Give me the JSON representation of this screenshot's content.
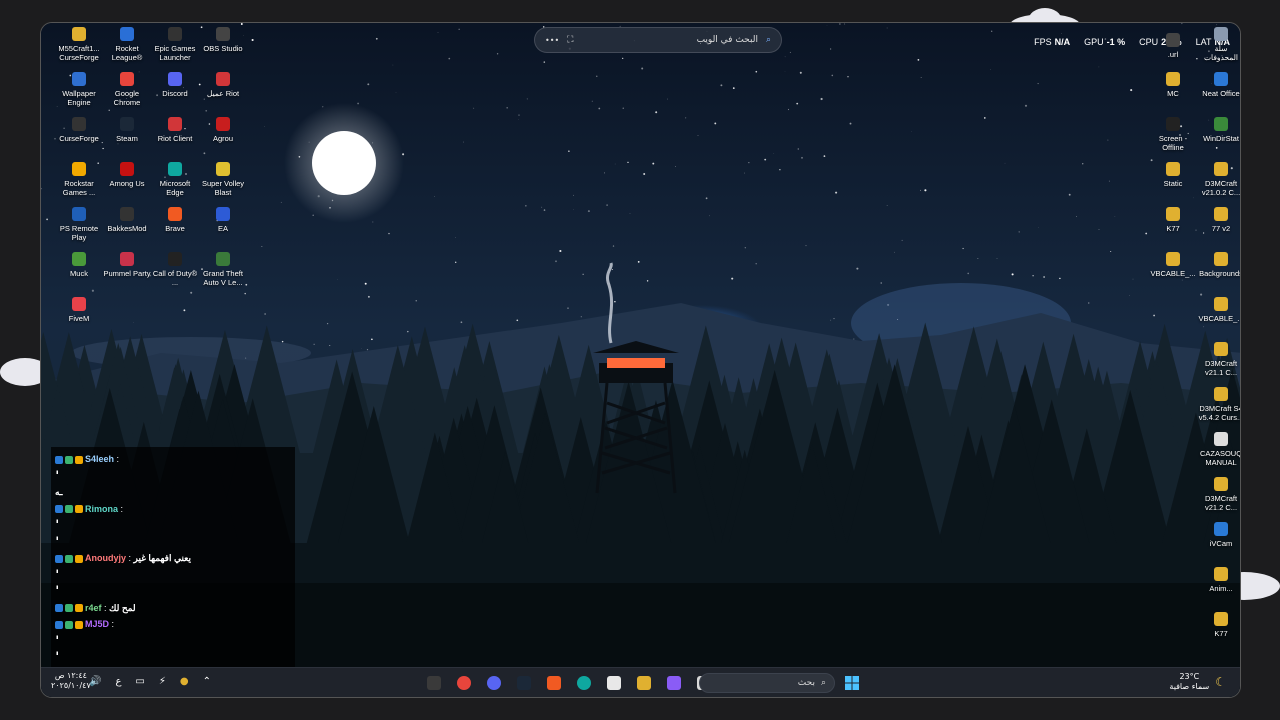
{
  "search_pill": {
    "placeholder": "البحث في الويب",
    "more": "•••"
  },
  "perf": [
    {
      "label": "LAT",
      "value": "N/A"
    },
    {
      "label": "CPU",
      "value": "23 %"
    },
    {
      "label": "GPU",
      "value": "-1 %"
    },
    {
      "label": "FPS",
      "value": "N/A"
    }
  ],
  "desktop_left": [
    {
      "label": "M55Craft1... CurseForge",
      "icon": "folder-icon",
      "color": "#e0b030"
    },
    {
      "label": "Rocket League®",
      "icon": "rocket-league-icon",
      "color": "#2a6fd6"
    },
    {
      "label": "Epic Games Launcher",
      "icon": "epic-icon",
      "color": "#333"
    },
    {
      "label": "OBS Studio",
      "icon": "obs-icon",
      "color": "#444"
    },
    {
      "label": "Wallpaper Engine",
      "icon": "wallpaper-engine-icon",
      "color": "#2f6fd0"
    },
    {
      "label": "Google Chrome",
      "icon": "chrome-icon",
      "color": "#e8453c"
    },
    {
      "label": "Discord",
      "icon": "discord-icon",
      "color": "#5865f2"
    },
    {
      "label": "عميل Riot",
      "icon": "riot-icon",
      "color": "#d13639"
    },
    {
      "label": "CurseForge",
      "icon": "curseforge-icon",
      "color": "#333"
    },
    {
      "label": "Steam",
      "icon": "steam-icon",
      "color": "#1b2838"
    },
    {
      "label": "Riot Client",
      "icon": "riot-client-icon",
      "color": "#d13639"
    },
    {
      "label": "Agrou",
      "icon": "agrou-icon",
      "color": "#c81e1e"
    },
    {
      "label": "Rockstar Games ...",
      "icon": "rockstar-icon",
      "color": "#f2a900"
    },
    {
      "label": "Among Us",
      "icon": "among-us-icon",
      "color": "#c51111"
    },
    {
      "label": "Microsoft Edge",
      "icon": "edge-icon",
      "color": "#0fa8a0"
    },
    {
      "label": "Super Volley Blast",
      "icon": "volley-icon",
      "color": "#e0c030"
    },
    {
      "label": "PS Remote Play",
      "icon": "ps-remote-icon",
      "color": "#1f5fb8"
    },
    {
      "label": "BakkesMod",
      "icon": "bakkesmod-icon",
      "color": "#333"
    },
    {
      "label": "Brave",
      "icon": "brave-icon",
      "color": "#f15a22"
    },
    {
      "label": "EA",
      "icon": "ea-icon",
      "color": "#2d5bd6"
    },
    {
      "label": "Muck",
      "icon": "muck-icon",
      "color": "#4a9a3a"
    },
    {
      "label": "Pummel Party",
      "icon": "pummel-party-icon",
      "color": "#c8324a"
    },
    {
      "label": "Call of Duty® ...",
      "icon": "cod-icon",
      "color": "#222"
    },
    {
      "label": "Grand Theft Auto V Le...",
      "icon": "gta-icon",
      "color": "#3a7a3a"
    },
    {
      "label": "FiveM",
      "icon": "fivem-icon",
      "color": "#e8424a"
    }
  ],
  "desktop_right": [
    {
      "label": "سلة المحذوفات",
      "icon": "recycle-bin-icon",
      "color": "#8a9ab0"
    },
    {
      "label": ".url",
      "icon": "url-icon",
      "color": "#444"
    },
    {
      "label": "Neat Office",
      "icon": "neat-office-icon",
      "color": "#2b78d6"
    },
    {
      "label": "MC",
      "icon": "folder-icon",
      "color": "#e0b030"
    },
    {
      "label": "WinDirStat",
      "icon": "windirstat-icon",
      "color": "#3a8a3a"
    },
    {
      "label": "Screen - Offline",
      "icon": "screen-icon",
      "color": "#222"
    },
    {
      "label": "D3MCraft v21.0.2 C...",
      "icon": "folder-icon",
      "color": "#e0b030"
    },
    {
      "label": "Static",
      "icon": "folder-icon",
      "color": "#e0b030"
    },
    {
      "label": "77 v2",
      "icon": "folder-icon",
      "color": "#e0b030"
    },
    {
      "label": "K77",
      "icon": "folder-icon",
      "color": "#e0b030"
    },
    {
      "label": "Backgrounds",
      "icon": "folder-icon",
      "color": "#e0b030"
    },
    {
      "label": "VBCABLE_...",
      "icon": "folder-icon",
      "color": "#e0b030"
    },
    {
      "label": "VBCABLE_...",
      "icon": "folder-icon",
      "color": "#e0b030"
    },
    {
      "label": "D3MCraft v21.1 C...",
      "icon": "folder-icon",
      "color": "#e0b030"
    },
    {
      "label": "D3MCraft S4 v5.4.2 Curs...",
      "icon": "folder-icon",
      "color": "#e0b030"
    },
    {
      "label": "CAZASOUQ MANUAL",
      "icon": "document-icon",
      "color": "#ddd"
    },
    {
      "label": "D3MCraft v21.2 C...",
      "icon": "folder-icon",
      "color": "#e0b030"
    },
    {
      "label": "iVCam",
      "icon": "ivcam-icon",
      "color": "#2a7ad6"
    },
    {
      "label": "Anim...",
      "icon": "folder-icon",
      "color": "#e0b030"
    },
    {
      "label": "K77",
      "icon": "folder-icon",
      "color": "#e0b030"
    }
  ],
  "chat": [
    {
      "user": "S4leeh",
      "color": "#9ad0ff",
      "sep": " :",
      "text": ""
    },
    {
      "user": "",
      "color": "#fff",
      "sep": "",
      "text": "ٰٰٰٰٰٰٰٰٰٰٰٰٰٰٰٰٰٰٰٰٰٰٰٰٰٰٰٰٰٰٰٰٰٰٰٰٰٰٰٰٰٰٰٰٰٰٰٰٰٰٰٰٰٰٰٰٰٰٰٰٰٰٰٰٰٰٰٰ"
    },
    {
      "user": "",
      "color": "#fff",
      "sep": "",
      "text": "ـه"
    },
    {
      "user": "Rimona",
      "color": "#5fd7c8",
      "sep": " :",
      "text": ""
    },
    {
      "user": "",
      "color": "#fff",
      "sep": "",
      "text": "ٰٰٰٰٰٰٰٰٰٰٰٰٰٰٰٰٰٰٰٰٰٰٰٰٰٰٰٰٰٰٰٰٰٰٰٰٰٰٰٰٰٰٰٰٰٰٰٰٰٰٰٰٰٰٰٰٰٰٰٰٰٰٰٰٰٰٰٰ"
    },
    {
      "user": "",
      "color": "#fff",
      "sep": "",
      "text": "ٰٰٰٰٰٰٰٰٰٰٰٰٰٰٰٰٰٰٰٰٰٰٰٰٰٰٰٰٰٰٰ"
    },
    {
      "user": "Anoudyjy",
      "color": "#ff7a7a",
      "sep": " : ",
      "text": "يعني افهمها غير"
    },
    {
      "user": "",
      "color": "#fff",
      "sep": "",
      "text": "ٰٰٰٰٰٰٰٰٰٰٰٰٰٰٰٰٰٰٰٰٰٰٰٰٰٰٰٰٰٰٰٰٰٰٰٰٰٰٰٰٰٰٰٰٰٰٰٰٰٰٰٰٰٰٰٰٰٰٰٰٰٰٰٰٰٰٰٰ"
    },
    {
      "user": "",
      "color": "#fff",
      "sep": "",
      "text": "ٰٰٰٰٰٰٰٰٰٰٰٰٰٰٰٰٰٰٰٰٰٰٰٰٰٰٰٰٰٰٰٰٰٰٰٰٰٰٰٰٰٰٰٰٰٰٰٰٰٰٰٰٰٰٰٰٰٰٰٰٰٰٰٰٰٰٰ"
    },
    {
      "user": "r4ef",
      "color": "#7bd88f",
      "sep": " : ",
      "text": "لمح لك"
    },
    {
      "user": "MJ5D",
      "color": "#b36bff",
      "sep": " :",
      "text": ""
    },
    {
      "user": "",
      "color": "#fff",
      "sep": "",
      "text": "ٰٰٰٰٰٰٰٰٰٰٰٰٰٰٰٰٰٰٰٰٰٰٰٰٰٰٰٰٰٰٰٰٰٰٰٰٰٰٰٰٰٰٰٰٰٰٰٰٰٰٰٰٰٰٰٰٰٰٰٰٰٰٰٰٰٰٰٰ"
    },
    {
      "user": "",
      "color": "#fff",
      "sep": "",
      "text": "ٰٰٰٰٰٰٰٰٰٰٰٰٰٰٰٰٰٰٰٰٰٰٰٰٰٰٰٰٰٰٰٰ"
    }
  ],
  "taskbar": {
    "clock_time": "١٢:٤٤ ص",
    "clock_date": "٢٠٢٥/١٠/٤٧",
    "lang": "ع",
    "search_placeholder": "بحث",
    "weather_temp": "23°C",
    "weather_desc": "سماء صافية",
    "apps": [
      {
        "icon": "obs-icon",
        "color": "#3a3a3a"
      },
      {
        "icon": "chrome-icon",
        "color": "#e8453c"
      },
      {
        "icon": "discord-icon",
        "color": "#5865f2"
      },
      {
        "icon": "steam-icon",
        "color": "#1b2838"
      },
      {
        "icon": "brave-icon",
        "color": "#f15a22"
      },
      {
        "icon": "edge-icon",
        "color": "#0fa8a0"
      },
      {
        "icon": "store-icon",
        "color": "#e8e8e8"
      },
      {
        "icon": "file-explorer-icon",
        "color": "#e0b030"
      },
      {
        "icon": "copilot-icon",
        "color": "#8a5cf6"
      },
      {
        "icon": "task-view-icon",
        "color": "#d8d8d8"
      }
    ]
  }
}
